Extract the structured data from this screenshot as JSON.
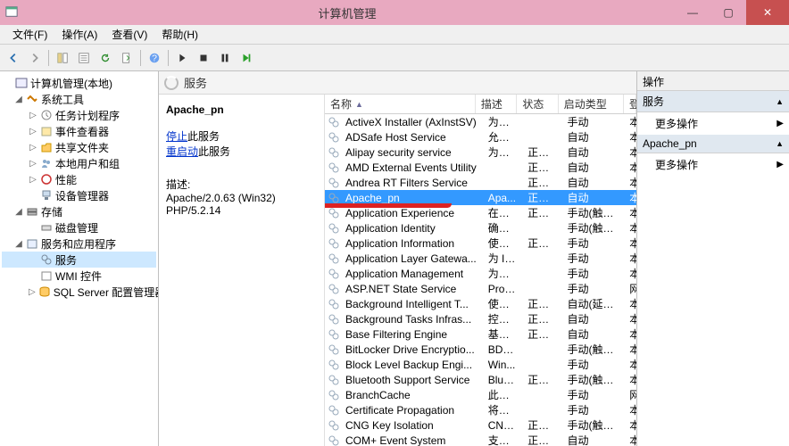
{
  "window": {
    "title": "计算机管理",
    "min": "—",
    "max": "▢",
    "close": "✕"
  },
  "menu": {
    "file": "文件(F)",
    "action": "操作(A)",
    "view": "查看(V)",
    "help": "帮助(H)"
  },
  "tree": {
    "root": "计算机管理(本地)",
    "sys_tools": "系统工具",
    "task_sched": "任务计划程序",
    "event_viewer": "事件查看器",
    "shared": "共享文件夹",
    "local_users": "本地用户和组",
    "perf": "性能",
    "dev_mgr": "设备管理器",
    "storage": "存储",
    "disk_mgmt": "磁盘管理",
    "svc_apps": "服务和应用程序",
    "services": "服务",
    "wmi": "WMI 控件",
    "sql": "SQL Server 配置管理器"
  },
  "services_header": "服务",
  "detail": {
    "name": "Apache_pn",
    "stop_link": "停止",
    "stop_suffix": "此服务",
    "restart_link": "重启动",
    "restart_suffix": "此服务",
    "desc_label": "描述:",
    "desc_value": "Apache/2.0.63 (Win32) PHP/5.2.14"
  },
  "columns": {
    "name": "名称",
    "desc": "描述",
    "status": "状态",
    "startup": "启动类型",
    "logon": "登"
  },
  "services": [
    {
      "name": "ActiveX Installer (AxInstSV)",
      "desc": "为从...",
      "status": "",
      "startup": "手动",
      "logon": "本"
    },
    {
      "name": "ADSafe Host Service",
      "desc": "允许...",
      "status": "",
      "startup": "自动",
      "logon": "本"
    },
    {
      "name": "Alipay security service",
      "desc": "为支...",
      "status": "正在...",
      "startup": "自动",
      "logon": "本"
    },
    {
      "name": "AMD External Events Utility",
      "desc": "",
      "status": "正在...",
      "startup": "自动",
      "logon": "本"
    },
    {
      "name": "Andrea RT Filters Service",
      "desc": "",
      "status": "正在...",
      "startup": "自动",
      "logon": "本"
    },
    {
      "name": "Apache_pn",
      "desc": "Apa...",
      "status": "正在...",
      "startup": "自动",
      "logon": "本",
      "selected": true,
      "marked": true
    },
    {
      "name": "Application Experience",
      "desc": "在应...",
      "status": "正在...",
      "startup": "手动(触发...",
      "logon": "本"
    },
    {
      "name": "Application Identity",
      "desc": "确定...",
      "status": "",
      "startup": "手动(触发...",
      "logon": "本"
    },
    {
      "name": "Application Information",
      "desc": "使用...",
      "status": "正在...",
      "startup": "手动",
      "logon": "本"
    },
    {
      "name": "Application Layer Gatewa...",
      "desc": "为 In...",
      "status": "",
      "startup": "手动",
      "logon": "本"
    },
    {
      "name": "Application Management",
      "desc": "为通...",
      "status": "",
      "startup": "手动",
      "logon": "本"
    },
    {
      "name": "ASP.NET State Service",
      "desc": "Prov...",
      "status": "",
      "startup": "手动",
      "logon": "网"
    },
    {
      "name": "Background Intelligent T...",
      "desc": "使用...",
      "status": "正在...",
      "startup": "自动(延迟...",
      "logon": "本"
    },
    {
      "name": "Background Tasks Infras...",
      "desc": "控制...",
      "status": "正在...",
      "startup": "自动",
      "logon": "本"
    },
    {
      "name": "Base Filtering Engine",
      "desc": "基本...",
      "status": "正在...",
      "startup": "自动",
      "logon": "本"
    },
    {
      "name": "BitLocker Drive Encryptio...",
      "desc": "BDE...",
      "status": "",
      "startup": "手动(触发...",
      "logon": "本"
    },
    {
      "name": "Block Level Backup Engi...",
      "desc": "Win...",
      "status": "",
      "startup": "手动",
      "logon": "本"
    },
    {
      "name": "Bluetooth Support Service",
      "desc": "Blue...",
      "status": "正在...",
      "startup": "手动(触发...",
      "logon": "本"
    },
    {
      "name": "BranchCache",
      "desc": "此服...",
      "status": "",
      "startup": "手动",
      "logon": "网"
    },
    {
      "name": "Certificate Propagation",
      "desc": "将用...",
      "status": "",
      "startup": "手动",
      "logon": "本"
    },
    {
      "name": "CNG Key Isolation",
      "desc": "CNG...",
      "status": "正在...",
      "startup": "手动(触发...",
      "logon": "本"
    },
    {
      "name": "COM+ Event System",
      "desc": "支持...",
      "status": "正在...",
      "startup": "自动",
      "logon": "本"
    }
  ],
  "actions": {
    "header": "操作",
    "sec1": "服务",
    "more": "更多操作",
    "sec2": "Apache_pn"
  }
}
